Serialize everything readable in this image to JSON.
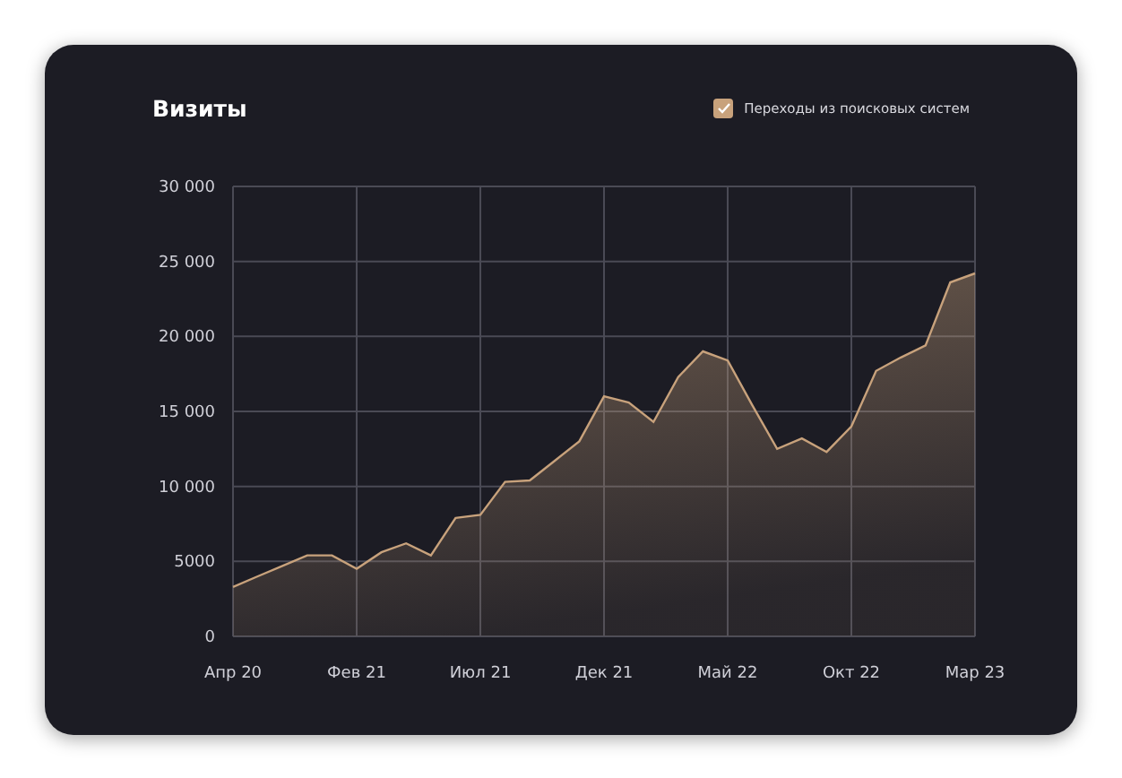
{
  "card": {
    "title": "Визиты",
    "legend": {
      "checked": true
    },
    "chart_data": {
      "type": "area",
      "grid": true,
      "ylim": [
        0,
        30000
      ],
      "yticks": [
        {
          "value": 0,
          "label": "0"
        },
        {
          "value": 5000,
          "label": "5000"
        },
        {
          "value": 10000,
          "label": "10 000"
        },
        {
          "value": 15000,
          "label": "15 000"
        },
        {
          "value": 20000,
          "label": "20 000"
        },
        {
          "value": 25000,
          "label": "25 000"
        },
        {
          "value": 30000,
          "label": "30 000"
        }
      ],
      "categories": [
        "Апр 20",
        null,
        null,
        null,
        null,
        "Фев 21",
        null,
        null,
        null,
        null,
        "Июл 21",
        null,
        null,
        null,
        null,
        "Дек 21",
        null,
        null,
        null,
        null,
        "Май 22",
        null,
        null,
        null,
        null,
        "Окт 22",
        null,
        null,
        null,
        null,
        "Мар 23"
      ],
      "series": [
        {
          "name": "Переходы из поисковых систем",
          "color": "#c8a27c",
          "values": [
            3300,
            4000,
            4700,
            5400,
            5400,
            4500,
            5600,
            6200,
            5400,
            7900,
            8100,
            10300,
            10400,
            11700,
            13000,
            16000,
            15600,
            14300,
            17300,
            19000,
            18400,
            15400,
            12500,
            13200,
            12300,
            14000,
            17700,
            18600,
            19400,
            23600,
            24200
          ]
        }
      ]
    }
  }
}
